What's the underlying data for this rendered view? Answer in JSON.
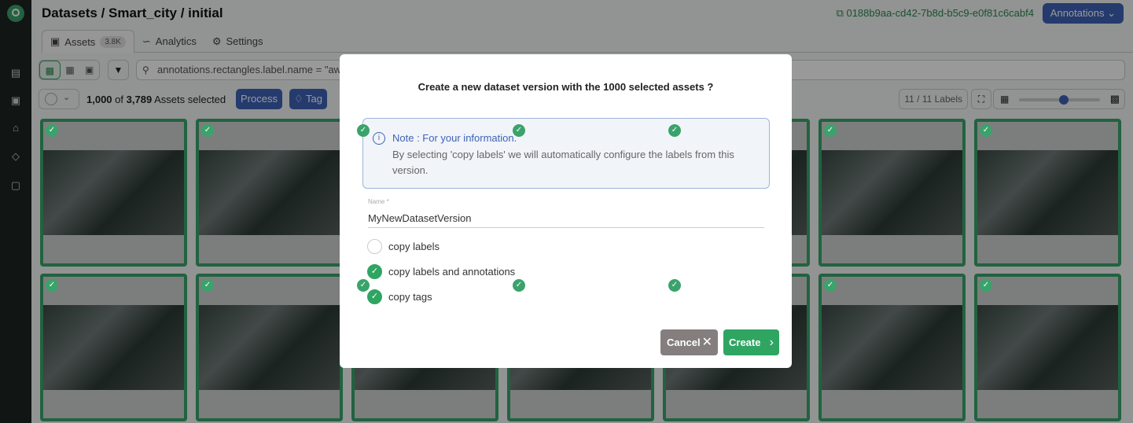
{
  "sidebar": {
    "icons": [
      "database-icon",
      "image-icon",
      "store-icon",
      "layers-icon",
      "models-icon"
    ]
  },
  "header": {
    "breadcrumb": "Datasets / Smart_city / initial",
    "version_id": "0188b9aa-cd42-7b8d-b5c9-e0f81c6cabf4",
    "mode_button": "Annotations"
  },
  "tabs": [
    {
      "label": "Assets",
      "badge": "3.8K"
    },
    {
      "label": "Analytics"
    },
    {
      "label": "Settings"
    }
  ],
  "search": {
    "query": "annotations.rectangles.label.name = \"aw"
  },
  "selection": {
    "count": "1,000",
    "of": "of",
    "total": "3,789",
    "suffix": "Assets selected"
  },
  "actions": {
    "process": "Process",
    "tag": "Tag"
  },
  "labels_filter": "11 / 11 Labels",
  "thumbnail_size_slider": 0.55,
  "grid": {
    "rows": 2,
    "columns": 7,
    "all_selected": true
  },
  "modal": {
    "title": "Create a new dataset version with the 1000 selected assets ?",
    "note_title": "Note : For your information.",
    "note_body": "By selecting 'copy labels' we will automatically configure the labels from this version.",
    "name_label": "Name *",
    "name_value": "MyNewDatasetVersion",
    "options": [
      {
        "label": "copy labels",
        "checked": false
      },
      {
        "label": "copy labels and annotations",
        "checked": true
      },
      {
        "label": "copy tags",
        "checked": true
      }
    ],
    "cancel": "Cancel",
    "create": "Create"
  },
  "colors": {
    "accent_green": "#3aa36b",
    "primary_blue": "#3f63b8",
    "cancel_gray": "#847e7e"
  }
}
